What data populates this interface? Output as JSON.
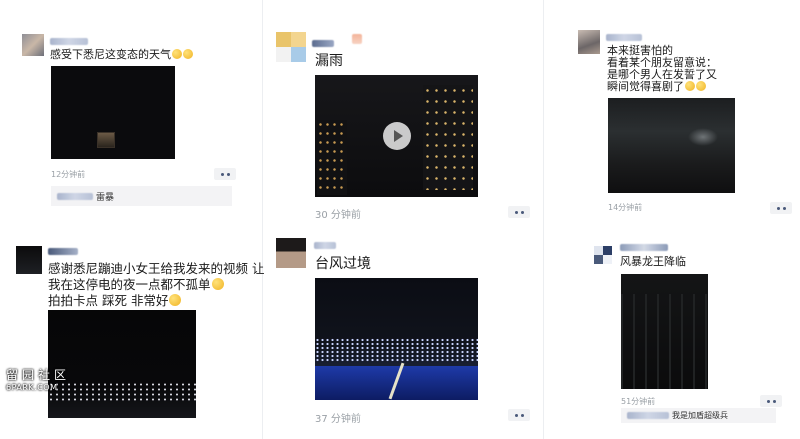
{
  "posts": [
    {
      "text_lines": [
        "感受下悉尼这变态的天气"
      ],
      "time": "12分钟前",
      "comment": "雷暴"
    },
    {
      "text_lines": [
        "漏雨"
      ],
      "time": "30 分钟前"
    },
    {
      "text_lines": [
        "本来挺害怕的",
        "看着某个朋友留意说：",
        "是哪个男人在发誓了又",
        "瞬间觉得喜剧了"
      ],
      "time": "14分钟前"
    },
    {
      "text_lines": [
        "感谢悉尼蹦迪小女王给我发来的视频 让",
        "我在这停电的夜一点都不孤单",
        "拍拍卡点 踩死 非常好"
      ]
    },
    {
      "text_lines": [
        "台风过境"
      ],
      "time": "37 分钟前"
    },
    {
      "text_lines": [
        "风暴龙王降临"
      ],
      "time": "51分钟前",
      "comment": "我是加盾超级兵"
    }
  ],
  "watermark": {
    "cn": "留园社区",
    "en": "6PARK.COM"
  },
  "icons": {
    "more": "more-dots-icon",
    "play": "play-icon",
    "emoji": "emoji-icon"
  },
  "colors": {
    "name_blur": "#b7c1d6",
    "time_gray": "#9aa0a6",
    "more_dots": "#4a5a7a"
  }
}
